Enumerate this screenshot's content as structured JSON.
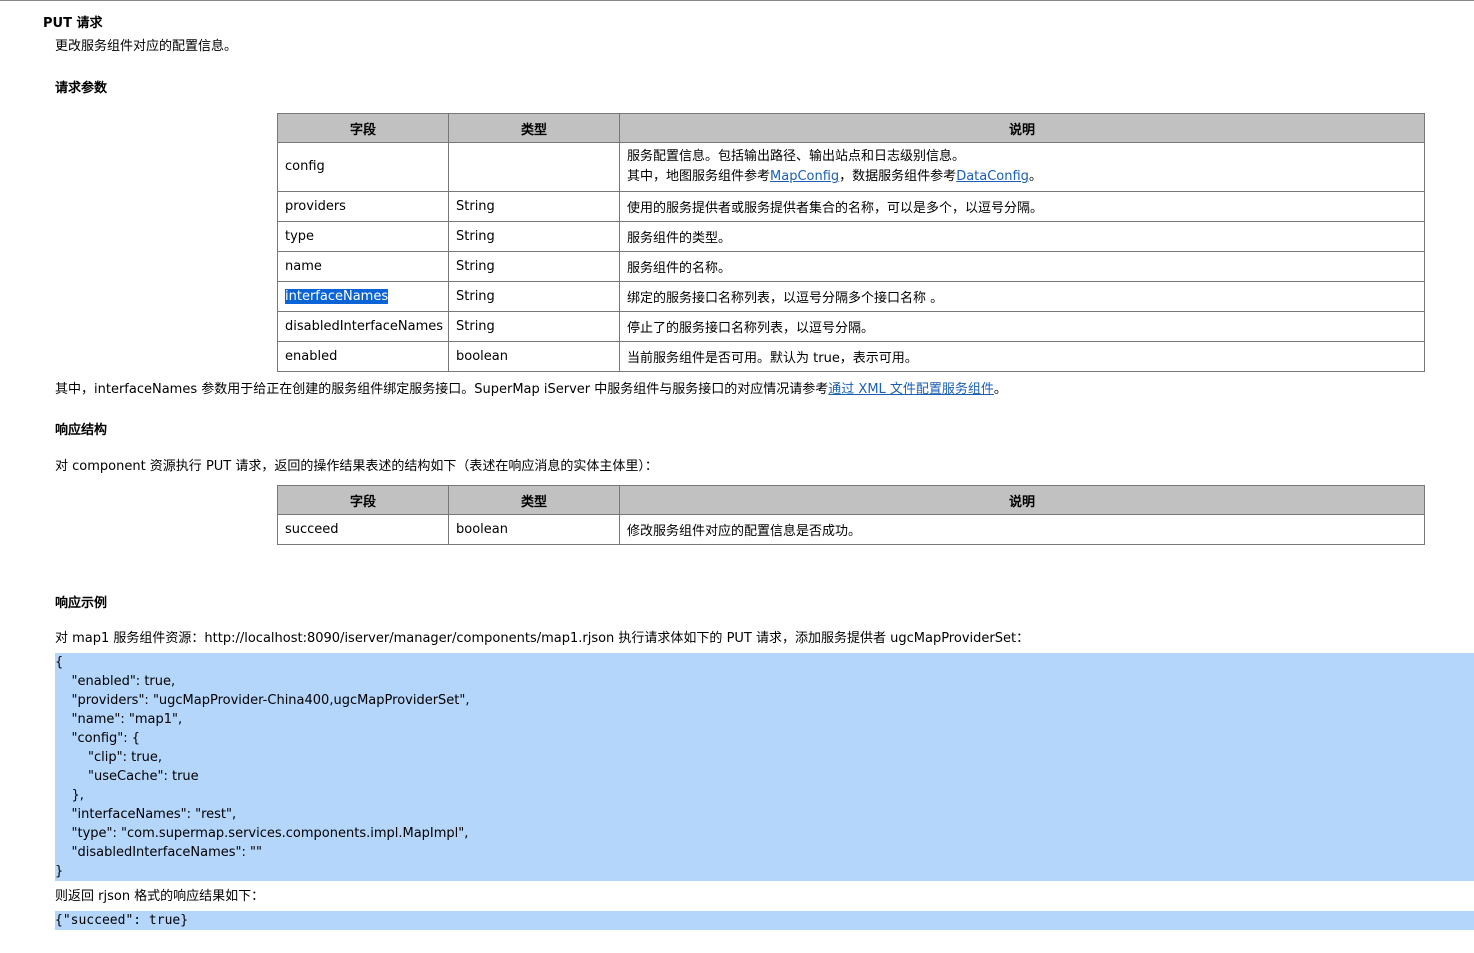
{
  "section_title": "PUT 请求",
  "description": "更改服务组件对应的配置信息。",
  "request_params": {
    "heading": "请求参数",
    "headers": [
      "字段",
      "类型",
      "说明"
    ],
    "rows": [
      {
        "field": "config",
        "type": "",
        "desc_line1": "服务配置信息。包括输出路径、输出站点和日志级别信息。",
        "desc_line2_prefix": "其中，地图服务组件参考",
        "link1": "MapConfig",
        "desc_line2_mid": "，数据服务组件参考",
        "link2": "DataConfig",
        "desc_line2_suffix": "。"
      },
      {
        "field": "providers",
        "type": "String",
        "desc": "使用的服务提供者或服务提供者集合的名称，可以是多个，以逗号分隔。"
      },
      {
        "field": "type",
        "type": "String",
        "desc": "服务组件的类型。"
      },
      {
        "field": "name",
        "type": "String",
        "desc": "服务组件的名称。"
      },
      {
        "field": "interfaceNames",
        "type": "String",
        "desc": "绑定的服务接口名称列表，以逗号分隔多个接口名称 。"
      },
      {
        "field": "disabledInterfaceNames",
        "type": "String",
        "desc": "停止了的服务接口名称列表，以逗号分隔。"
      },
      {
        "field": "enabled",
        "type": "boolean",
        "desc": "当前服务组件是否可用。默认为 true，表示可用。"
      }
    ]
  },
  "note": {
    "text": "其中，interfaceNames 参数用于给正在创建的服务组件绑定服务接口。SuperMap iServer 中服务组件与服务接口的对应情况请参考",
    "link": "通过 XML 文件配置服务组件",
    "suffix": "。"
  },
  "response_structure": {
    "heading": "响应结构",
    "intro": "对 component 资源执行 PUT 请求，返回的操作结果表述的结构如下（表述在响应消息的实体主体里）：",
    "headers": [
      "字段",
      "类型",
      "说明"
    ],
    "rows": [
      {
        "field": "succeed",
        "type": "boolean",
        "desc": "修改服务组件对应的配置信息是否成功。"
      }
    ]
  },
  "response_example": {
    "heading": "响应示例",
    "intro": "对 map1 服务组件资源：http://localhost:8090/iserver/manager/components/map1.rjson 执行请求体如下的 PUT 请求，添加服务提供者 ugcMapProviderSet：",
    "request_body": "{\n    \"enabled\": true,\n    \"providers\": \"ugcMapProvider-China400,ugcMapProviderSet\",\n    \"name\": \"map1\",\n    \"config\": {\n        \"clip\": true,\n        \"useCache\": true\n    },\n    \"interfaceNames\": \"rest\",\n    \"type\": \"com.supermap.services.components.impl.MapImpl\",\n    \"disabledInterfaceNames\": \"\"\n}",
    "result_intro": "则返回 rjson 格式的响应结果如下：",
    "result_body": "{\"succeed\": true}"
  },
  "colors": {
    "table_header_bg": "#c1c1c1",
    "code_highlight_bg": "#b4d6fb",
    "link": "#1a5fb4",
    "selection": "#0a64d6"
  }
}
